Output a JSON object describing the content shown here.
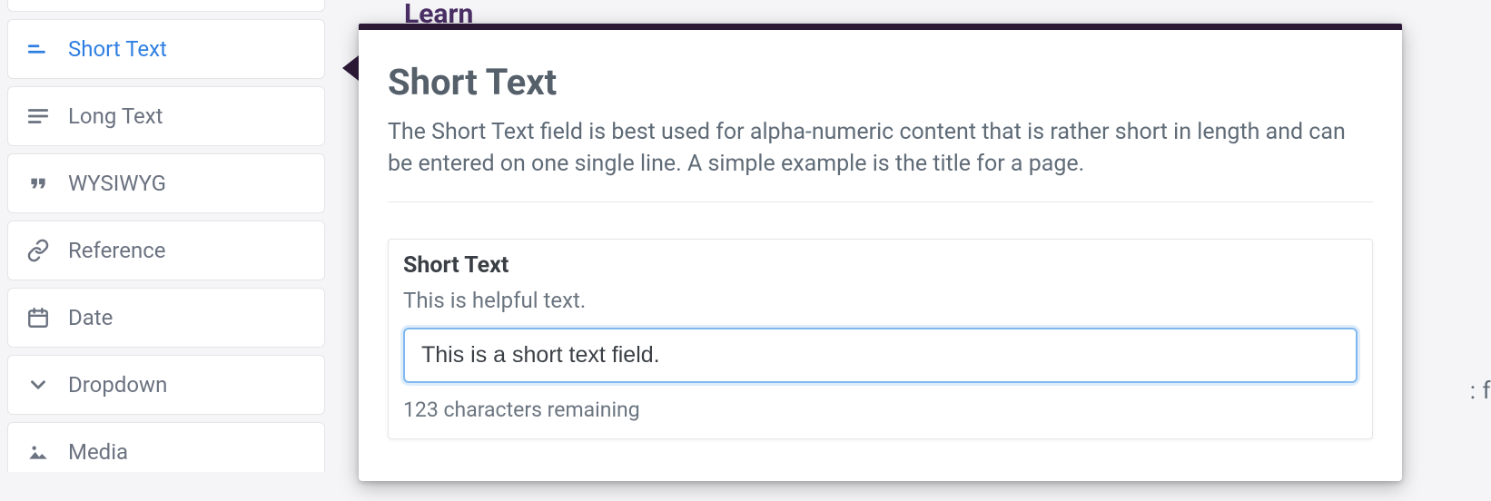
{
  "sidebar": {
    "items": [
      {
        "label": "Short Text",
        "icon": "short-text-icon",
        "active": true
      },
      {
        "label": "Long Text",
        "icon": "long-text-icon",
        "active": false
      },
      {
        "label": "WYSIWYG",
        "icon": "quotes-icon",
        "active": false
      },
      {
        "label": "Reference",
        "icon": "link-icon",
        "active": false
      },
      {
        "label": "Date",
        "icon": "calendar-icon",
        "active": false
      },
      {
        "label": "Dropdown",
        "icon": "chevron-down-icon",
        "active": false
      },
      {
        "label": "Media",
        "icon": "image-icon",
        "active": false
      }
    ]
  },
  "main": {
    "learn_label": "Learn",
    "popover": {
      "title": "Short Text",
      "description": "The Short Text field is best used for alpha-numeric content that is rather short in length and can be entered on one single line. A simple example is the title for a page.",
      "field": {
        "label": "Short Text",
        "hint": "This is helpful text.",
        "value": "This is a short text field.",
        "counter": "123 characters remaining"
      }
    },
    "right_fragment": ": f"
  }
}
